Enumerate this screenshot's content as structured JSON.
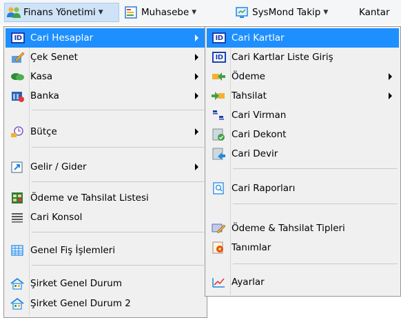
{
  "menubar": {
    "items": [
      {
        "label": "Finans Yönetimi",
        "icon": "users-icon"
      },
      {
        "label": "Muhasebe",
        "icon": "ledger-icon"
      },
      {
        "label": "SysMond Takip",
        "icon": "monitor-icon"
      },
      {
        "label": "Kantar",
        "icon": ""
      }
    ]
  },
  "menu1": {
    "items": [
      {
        "label": "Cari Hesaplar",
        "icon": "id-card-icon",
        "submenu": true,
        "highlighted": true
      },
      {
        "label": "Çek Senet",
        "icon": "pen-document-icon",
        "submenu": true
      },
      {
        "label": "Kasa",
        "icon": "money-icon",
        "submenu": true
      },
      {
        "label": "Banka",
        "icon": "bank-icon",
        "submenu": true
      },
      {
        "label": "Bütçe",
        "icon": "budget-icon",
        "submenu": true
      },
      {
        "label": "Gelir / Gider",
        "icon": "income-expense-icon",
        "submenu": true
      },
      {
        "label": "Ödeme ve Tahsilat Listesi",
        "icon": "list-grid-icon",
        "submenu": false
      },
      {
        "label": "Cari Konsol",
        "icon": "console-lines-icon",
        "submenu": false
      },
      {
        "label": "Genel Fiş İşlemleri",
        "icon": "table-icon",
        "submenu": false
      },
      {
        "label": "Şirket Genel Durum",
        "icon": "company-status-icon",
        "submenu": false
      },
      {
        "label": "Şirket Genel Durum 2",
        "icon": "company-status-icon",
        "submenu": false
      }
    ]
  },
  "menu2": {
    "items": [
      {
        "label": "Cari Kartlar",
        "icon": "id-card-icon",
        "submenu": false,
        "highlighted": true
      },
      {
        "label": "Cari Kartlar Liste Giriş",
        "icon": "id-card-icon",
        "submenu": false
      },
      {
        "label": "Ödeme",
        "icon": "payment-arrow-icon",
        "submenu": true
      },
      {
        "label": "Tahsilat",
        "icon": "collection-arrow-icon",
        "submenu": true
      },
      {
        "label": "Cari Virman",
        "icon": "transfer-icon",
        "submenu": false
      },
      {
        "label": "Cari Dekont",
        "icon": "receipt-icon",
        "submenu": false
      },
      {
        "label": "Cari Devir",
        "icon": "carryover-icon",
        "submenu": false
      },
      {
        "label": "Cari Raporları",
        "icon": "report-icon",
        "submenu": false
      },
      {
        "label": "Ödeme & Tahsilat Tipleri",
        "icon": "types-icon",
        "submenu": false
      },
      {
        "label": "Tanımlar",
        "icon": "definitions-icon",
        "submenu": false
      },
      {
        "label": "Ayarlar",
        "icon": "settings-chart-icon",
        "submenu": false
      }
    ]
  },
  "colors": {
    "highlight": "#1e8fff",
    "menu_bg": "#f0f0f0",
    "menubar_active": "#cfe3f7"
  }
}
